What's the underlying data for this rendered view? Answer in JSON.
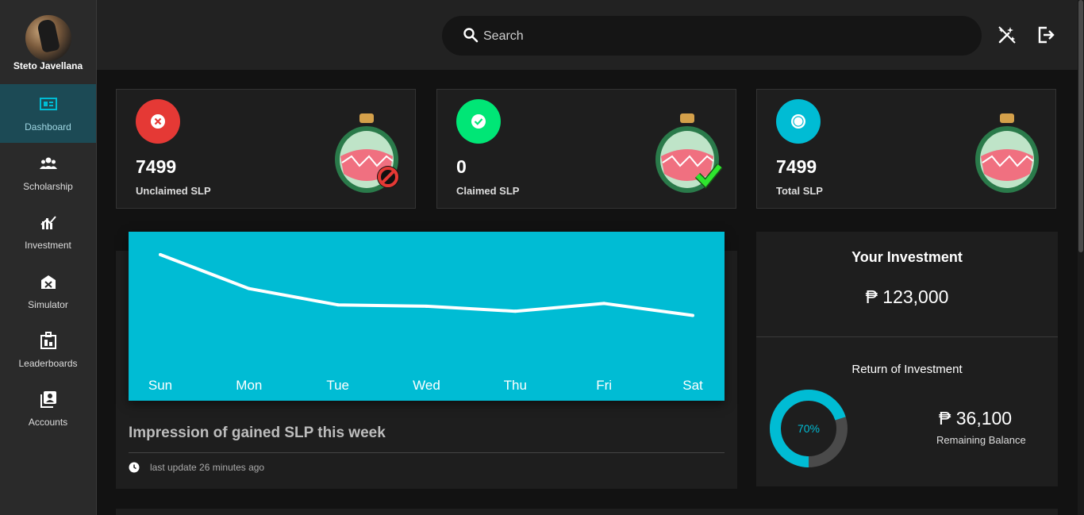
{
  "user": {
    "name": "Steto Javellana"
  },
  "sidebar": {
    "items": [
      {
        "label": "Dashboard",
        "icon": "dashboard-icon",
        "active": true
      },
      {
        "label": "Scholarship",
        "icon": "people-icon"
      },
      {
        "label": "Investment",
        "icon": "investment-icon"
      },
      {
        "label": "Simulator",
        "icon": "simulator-icon"
      },
      {
        "label": "Leaderboards",
        "icon": "leaderboards-icon"
      },
      {
        "label": "Accounts",
        "icon": "accounts-icon"
      }
    ]
  },
  "search": {
    "placeholder": "Search"
  },
  "header": {
    "icons": [
      "magic-wand-icon",
      "logout-icon"
    ]
  },
  "stats": [
    {
      "value": "7499",
      "label": "Unclaimed SLP",
      "color": "#e53935",
      "icon": "close-icon"
    },
    {
      "value": "0",
      "label": "Claimed SLP",
      "color": "#00e676",
      "icon": "check-icon"
    },
    {
      "value": "7499",
      "label": "Total SLP",
      "color": "#00bcd4",
      "icon": "dot-icon"
    }
  ],
  "chart": {
    "title": "Impression of gained SLP this week",
    "update": "last update 26 minutes ago"
  },
  "chart_data": {
    "type": "line",
    "categories": [
      "Sun",
      "Mon",
      "Tue",
      "Wed",
      "Thu",
      "Fri",
      "Sat"
    ],
    "series": [
      {
        "values": [
          100,
          52,
          29,
          27,
          20,
          31,
          14
        ]
      }
    ],
    "ylim": [
      0,
      110
    ],
    "grid": false,
    "background": "#00bcd4",
    "line_color": "#ffffff"
  },
  "investment": {
    "title": "Your Investment",
    "amount": "₱ 123,000",
    "roi_title": "Return of Investment",
    "roi_percent_label": "70%",
    "roi_fraction": 0.7,
    "remaining_amount": "₱ 36,100",
    "remaining_label": "Remaining Balance"
  }
}
